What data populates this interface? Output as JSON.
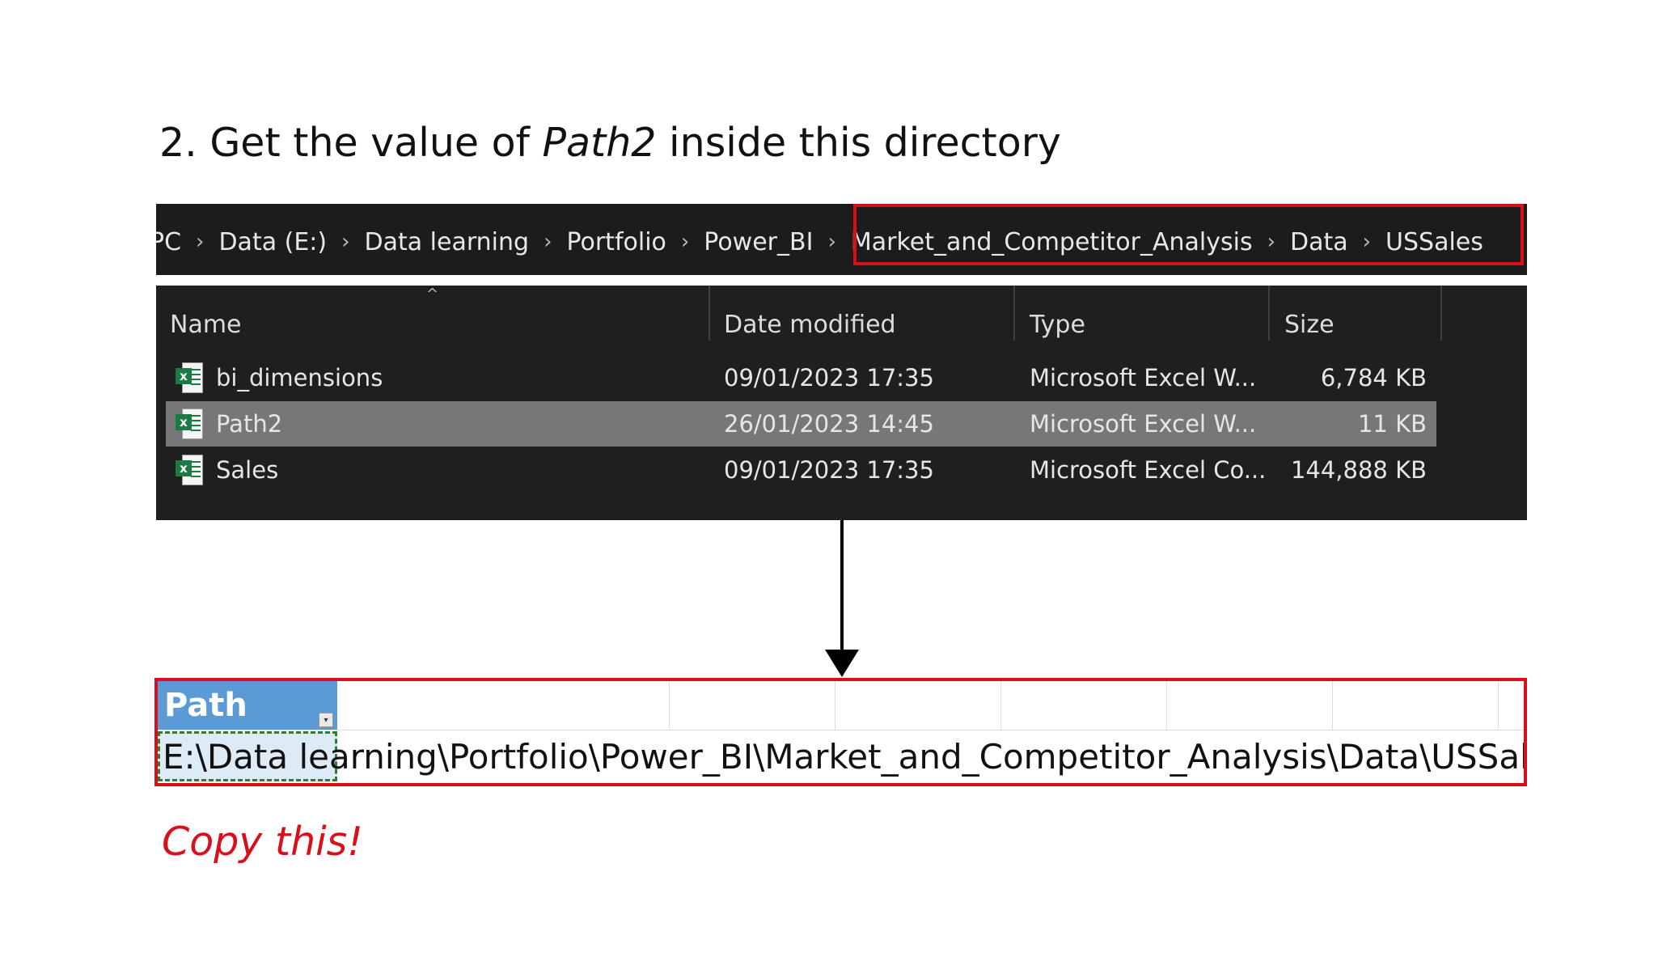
{
  "heading": {
    "prefix": "2. Get the value of ",
    "emphasis": "Path2",
    "suffix": " inside this directory"
  },
  "breadcrumb": {
    "items": [
      "PC",
      "Data (E:)",
      "Data learning",
      "Portfolio",
      "Power_BI",
      "Market_and_Competitor_Analysis",
      "Data",
      "USSales"
    ],
    "separator": "›",
    "highlight_color": "#d9101a"
  },
  "file_list": {
    "columns": [
      "Name",
      "Date modified",
      "Type",
      "Size"
    ],
    "files": [
      {
        "name": "bi_dimensions",
        "date": "09/01/2023 17:35",
        "type": "Microsoft Excel W...",
        "size": "6,784 KB",
        "selected": false
      },
      {
        "name": "Path2",
        "date": "26/01/2023 14:45",
        "type": "Microsoft Excel W...",
        "size": "11 KB",
        "selected": true
      },
      {
        "name": "Sales",
        "date": "09/01/2023 17:35",
        "type": "Microsoft Excel Co...",
        "size": "144,888 KB",
        "selected": false
      }
    ],
    "icon": "excel-file-icon"
  },
  "sheet": {
    "header": "Path",
    "value": "E:\\Data learning\\Portfolio\\Power_BI\\Market_and_Competitor_Analysis\\Data\\USSales\\",
    "header_color": "#5b9bd5"
  },
  "note": "Copy this!"
}
